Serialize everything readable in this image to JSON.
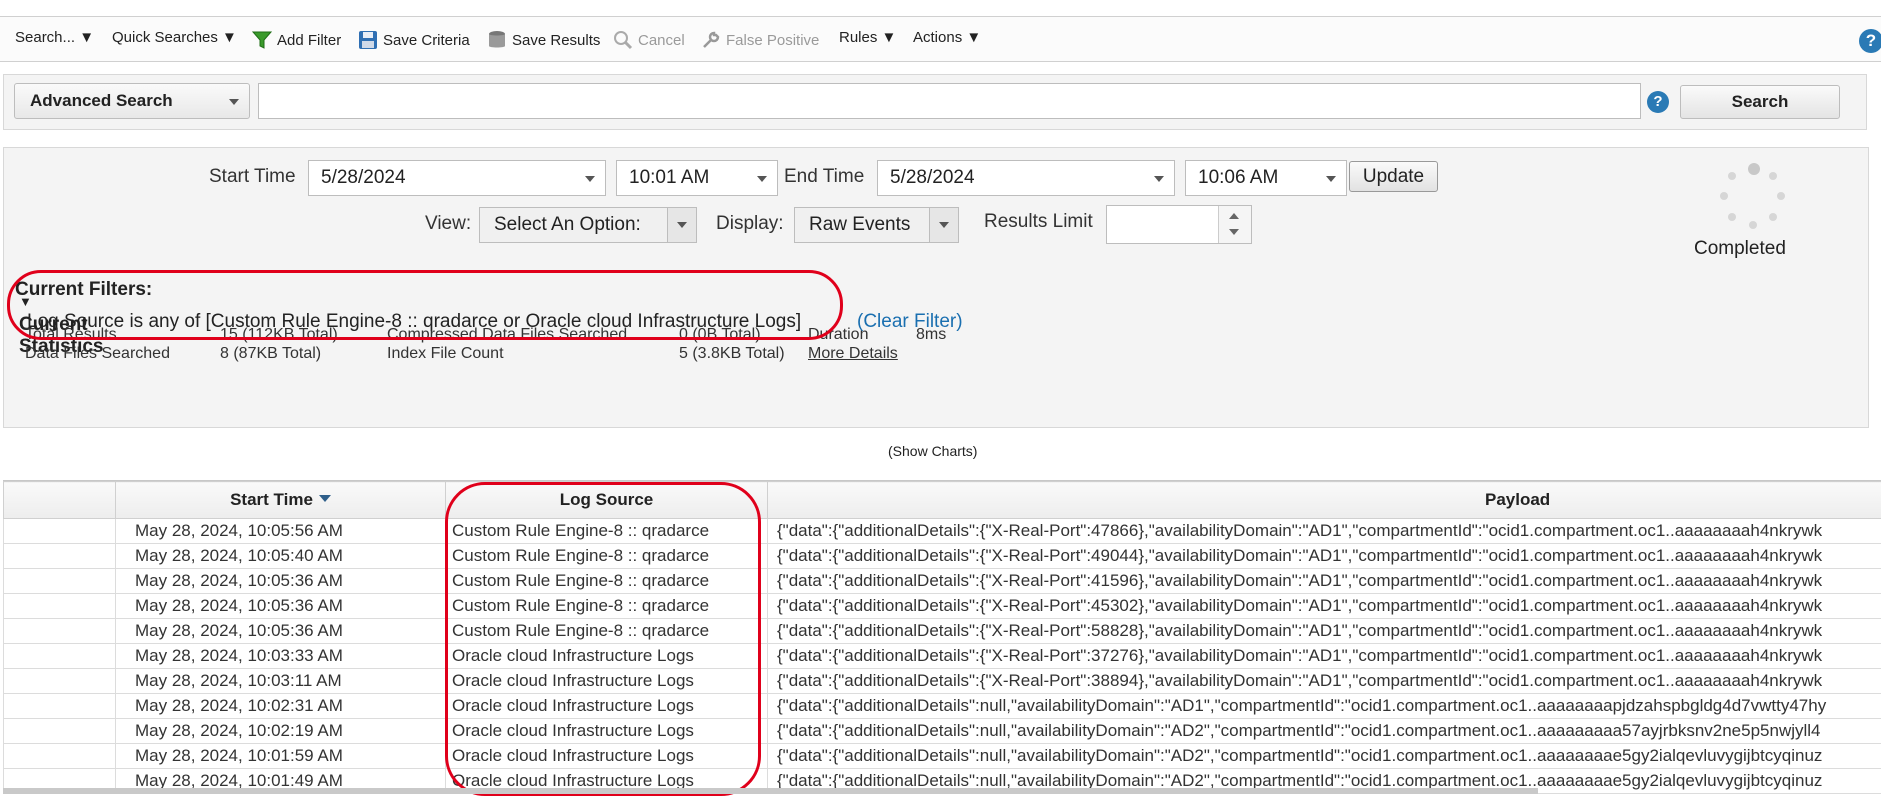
{
  "toolbar": {
    "items": [
      {
        "label": "Search... ▼"
      },
      {
        "label": "Quick Searches ▼"
      },
      {
        "label": "Add Filter",
        "icon": "filter-icon"
      },
      {
        "label": "Save Criteria",
        "icon": "floppy-disk-icon"
      },
      {
        "label": "Save Results",
        "icon": "database-icon"
      },
      {
        "label": "Cancel",
        "icon": "cancel-search-icon",
        "disabled": true
      },
      {
        "label": "False Positive",
        "icon": "wrench-icon",
        "disabled": true
      },
      {
        "label": "Rules ▼"
      },
      {
        "label": "Actions ▼"
      }
    ],
    "help": "?"
  },
  "search": {
    "mode": "Advanced Search",
    "query": "",
    "help": "?",
    "button": "Search"
  },
  "criteria": {
    "start_label": "Start Time",
    "start_date": "5/28/2024",
    "start_time": "10:01 AM",
    "end_label": "End Time",
    "end_date": "5/28/2024",
    "end_time": "10:06 AM",
    "update": "Update",
    "view_label": "View:",
    "view_value": "Select An Option:",
    "display_label": "Display:",
    "display_value": "Raw Events",
    "limit_label": "Results Limit",
    "limit_value": "",
    "status": "Completed"
  },
  "filters": {
    "title": "Current Filters:",
    "text": "Log Source is any of [Custom Rule Engine-8 :: qradarce or Oracle cloud Infrastructure Logs]",
    "clear": "(Clear Filter)"
  },
  "statistics": {
    "title": "Current Statistics",
    "total_results_label": "Total Results",
    "total_results_value": "15 (112KB Total)",
    "data_files_label": "Data Files Searched",
    "data_files_value": "8 (87KB Total)",
    "compressed_label": "Compressed Data Files Searched",
    "compressed_value": "0 (0B Total)",
    "index_label": "Index File Count",
    "index_value": "5 (3.8KB Total)",
    "duration_label": "Duration",
    "duration_value": "8ms",
    "more_details": "More Details"
  },
  "show_charts": "(Show Charts)",
  "table": {
    "columns": [
      "",
      "Start Time",
      "Log Source",
      "Payload"
    ],
    "rows": [
      {
        "time": "May 28, 2024, 10:05:56 AM",
        "source": "Custom Rule Engine-8 :: qradarce",
        "payload": "{\"data\":{\"additionalDetails\":{\"X-Real-Port\":47866},\"availabilityDomain\":\"AD1\",\"compartmentId\":\"ocid1.compartment.oc1..aaaaaaaah4nkrywk"
      },
      {
        "time": "May 28, 2024, 10:05:40 AM",
        "source": "Custom Rule Engine-8 :: qradarce",
        "payload": "{\"data\":{\"additionalDetails\":{\"X-Real-Port\":49044},\"availabilityDomain\":\"AD1\",\"compartmentId\":\"ocid1.compartment.oc1..aaaaaaaah4nkrywk"
      },
      {
        "time": "May 28, 2024, 10:05:36 AM",
        "source": "Custom Rule Engine-8 :: qradarce",
        "payload": "{\"data\":{\"additionalDetails\":{\"X-Real-Port\":41596},\"availabilityDomain\":\"AD1\",\"compartmentId\":\"ocid1.compartment.oc1..aaaaaaaah4nkrywk"
      },
      {
        "time": "May 28, 2024, 10:05:36 AM",
        "source": "Custom Rule Engine-8 :: qradarce",
        "payload": "{\"data\":{\"additionalDetails\":{\"X-Real-Port\":45302},\"availabilityDomain\":\"AD1\",\"compartmentId\":\"ocid1.compartment.oc1..aaaaaaaah4nkrywk"
      },
      {
        "time": "May 28, 2024, 10:05:36 AM",
        "source": "Custom Rule Engine-8 :: qradarce",
        "payload": "{\"data\":{\"additionalDetails\":{\"X-Real-Port\":58828},\"availabilityDomain\":\"AD1\",\"compartmentId\":\"ocid1.compartment.oc1..aaaaaaaah4nkrywk"
      },
      {
        "time": "May 28, 2024, 10:03:33 AM",
        "source": "Oracle cloud Infrastructure Logs",
        "payload": "{\"data\":{\"additionalDetails\":{\"X-Real-Port\":37276},\"availabilityDomain\":\"AD1\",\"compartmentId\":\"ocid1.compartment.oc1..aaaaaaaah4nkrywk"
      },
      {
        "time": "May 28, 2024, 10:03:11 AM",
        "source": "Oracle cloud Infrastructure Logs",
        "payload": "{\"data\":{\"additionalDetails\":{\"X-Real-Port\":38894},\"availabilityDomain\":\"AD1\",\"compartmentId\":\"ocid1.compartment.oc1..aaaaaaaah4nkrywk"
      },
      {
        "time": "May 28, 2024, 10:02:31 AM",
        "source": "Oracle cloud Infrastructure Logs",
        "payload": "{\"data\":{\"additionalDetails\":null,\"availabilityDomain\":\"AD1\",\"compartmentId\":\"ocid1.compartment.oc1..aaaaaaaapjdzahspbgldg4d7vwtty47hy"
      },
      {
        "time": "May 28, 2024, 10:02:19 AM",
        "source": "Oracle cloud Infrastructure Logs",
        "payload": "{\"data\":{\"additionalDetails\":null,\"availabilityDomain\":\"AD2\",\"compartmentId\":\"ocid1.compartment.oc1..aaaaaaaaa57ayjrbksnv2ne5p5nwjyll4"
      },
      {
        "time": "May 28, 2024, 10:01:59 AM",
        "source": "Oracle cloud Infrastructure Logs",
        "payload": "{\"data\":{\"additionalDetails\":null,\"availabilityDomain\":\"AD2\",\"compartmentId\":\"ocid1.compartment.oc1..aaaaaaaae5gy2ialqevluvygijbtcyqinuz"
      },
      {
        "time": "May 28, 2024, 10:01:49 AM",
        "source": "Oracle cloud Infrastructure Logs",
        "payload": "{\"data\":{\"additionalDetails\":null,\"availabilityDomain\":\"AD2\",\"compartmentId\":\"ocid1.compartment.oc1..aaaaaaaae5gy2ialqevluvygijbtcyqinuz"
      }
    ]
  },
  "colors": {
    "accent": "#2a7ab5",
    "link": "#1a6fb0",
    "highlight": "#e0001b"
  }
}
